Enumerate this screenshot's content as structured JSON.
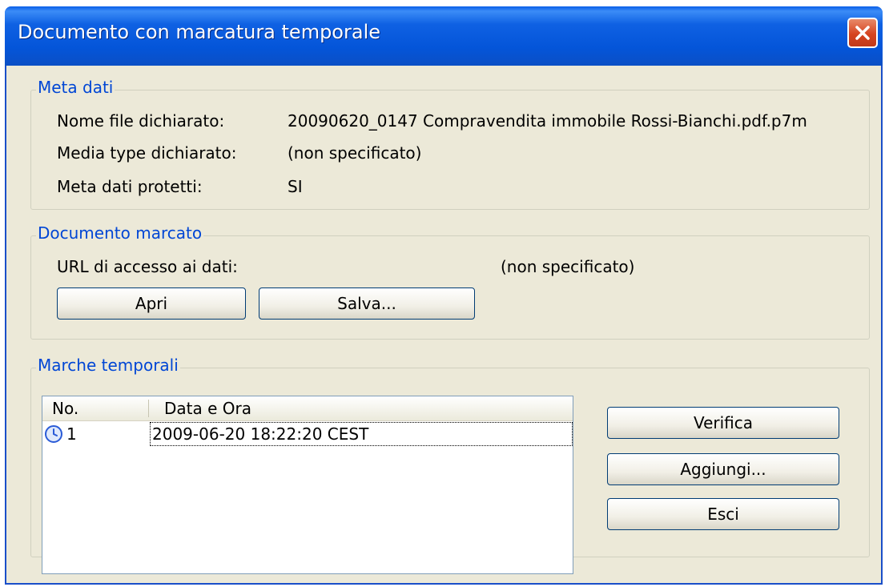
{
  "window": {
    "title": "Documento con marcatura temporale"
  },
  "meta": {
    "legend": "Meta dati",
    "rows": [
      {
        "label": "Nome file dichiarato:",
        "value": "20090620_0147 Compravendita immobile Rossi-Bianchi.pdf.p7m"
      },
      {
        "label": "Media type dichiarato:",
        "value": "(non specificato)"
      },
      {
        "label": "Meta dati protetti:",
        "value": "SI"
      }
    ]
  },
  "document": {
    "legend": "Documento marcato",
    "url_label": "URL di accesso ai dati:",
    "url_value": "(non specificato)",
    "open_label": "Apri",
    "save_label": "Salva..."
  },
  "timestamps": {
    "legend": "Marche temporali",
    "columns": [
      "No.",
      "Data e Ora"
    ],
    "rows": [
      {
        "no": "1",
        "datetime": "2009-06-20 18:22:20 CEST",
        "icon": "clock-icon"
      }
    ],
    "verify_label": "Verifica",
    "add_label": "Aggiungi...",
    "exit_label": "Esci"
  },
  "colors": {
    "titlebar": "#0455d9",
    "legend_text": "#0046d5",
    "dialog_bg": "#ece9d8",
    "close_button": "#d6431f"
  }
}
